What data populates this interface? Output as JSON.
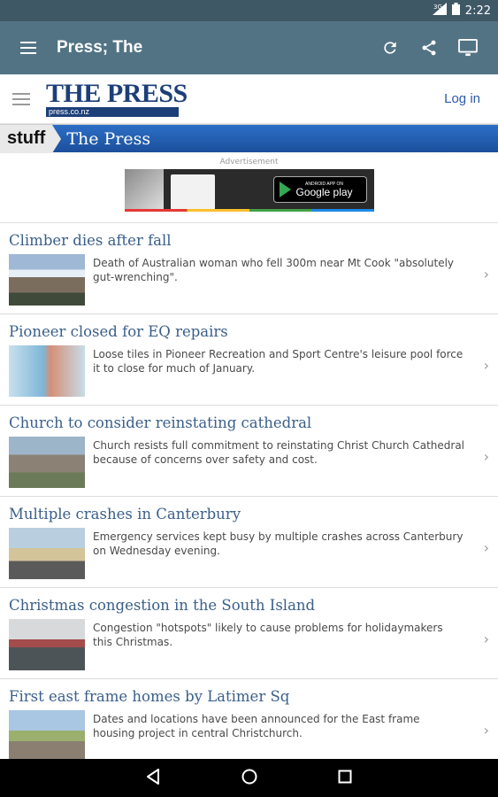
{
  "status_bar": {
    "signal": "3G",
    "time": "2:22"
  },
  "app_bar": {
    "title": "Press; The"
  },
  "site_header": {
    "logo_text": "THE PRESS",
    "logo_sub": "press.co.nz",
    "login_label": "Log in"
  },
  "section_bar": {
    "brand": "stuff",
    "title": "The Press"
  },
  "advertisement": {
    "label": "Advertisement",
    "store_badge": "Google play",
    "store_badge_top": "ANDROID APP ON"
  },
  "articles": [
    {
      "headline": "Climber dies after fall",
      "summary": "Death of Australian woman who fell 300m near Mt Cook \"absolutely gut-wrenching\"."
    },
    {
      "headline": "Pioneer closed for EQ repairs",
      "summary": "Loose tiles in Pioneer Recreation and Sport Centre's leisure pool force it to close for much of January."
    },
    {
      "headline": "Church to consider reinstating cathedral",
      "summary": "Church resists full commitment to reinstating Christ Church Cathedral because of concerns over safety and cost."
    },
    {
      "headline": "Multiple crashes in Canterbury",
      "summary": "Emergency services kept busy by multiple crashes across Canterbury on Wednesday evening."
    },
    {
      "headline": "Christmas congestion in the South Island",
      "summary": "Congestion \"hotspots\" likely to cause problems for holidaymakers this Christmas."
    },
    {
      "headline": "First east frame homes by Latimer Sq",
      "summary": "Dates and locations have been announced for the East frame housing project in central Christchurch."
    }
  ],
  "colors": {
    "app_bar": "#527384",
    "status_bar": "#3f5866",
    "headline": "#3a5f8a",
    "section_bar": "#2c6fc6"
  }
}
